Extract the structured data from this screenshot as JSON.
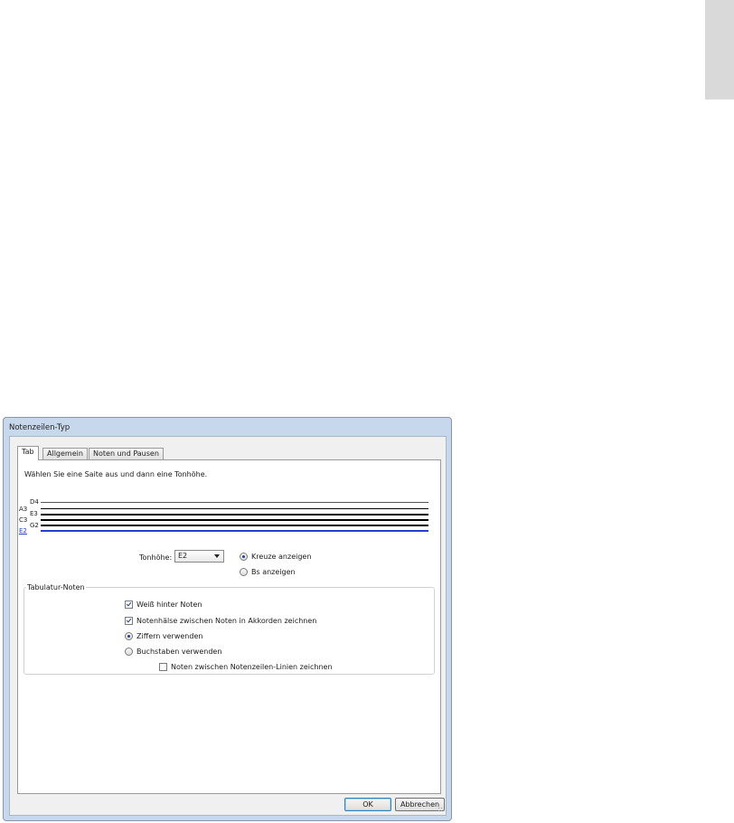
{
  "dialog": {
    "title": "Notenzeilen-Typ",
    "tabs": [
      "Tab",
      "Allgemein",
      "Noten und Pausen"
    ],
    "active_tab": "Tab"
  },
  "tab_panel": {
    "instruction": "Wählen Sie eine Saite aus und dann eine Tonhöhe.",
    "strings": [
      {
        "label": "D4",
        "selected": false
      },
      {
        "label": "A3",
        "selected": false
      },
      {
        "label": "E3",
        "selected": false
      },
      {
        "label": "C3",
        "selected": false
      },
      {
        "label": "G2",
        "selected": false
      },
      {
        "label": "E2",
        "selected": true
      }
    ],
    "pitch": {
      "label": "Tonhöhe:",
      "value": "E2"
    },
    "accidentals": {
      "sharps_label": "Kreuze anzeigen",
      "sharps_checked": true,
      "flats_label": "Bs anzeigen",
      "flats_checked": false
    },
    "tab_notes_group": {
      "title": "Tabulatur-Noten",
      "white_behind_label": "Weiß hinter Noten",
      "white_behind_checked": true,
      "stems_label": "Notenhälse zwischen Noten in Akkorden zeichnen",
      "stems_checked": true,
      "digits_label": "Ziffern verwenden",
      "digits_checked": true,
      "letters_label": "Buchstaben verwenden",
      "letters_checked": false,
      "between_lines_label": "Noten zwischen Notenzeilen-Linien zeichnen",
      "between_lines_checked": false
    }
  },
  "buttons": {
    "ok": "OK",
    "cancel": "Abbrechen"
  },
  "colors": {
    "selected_string": "#2a3bd4",
    "title_bar": "#c7d8ec"
  }
}
